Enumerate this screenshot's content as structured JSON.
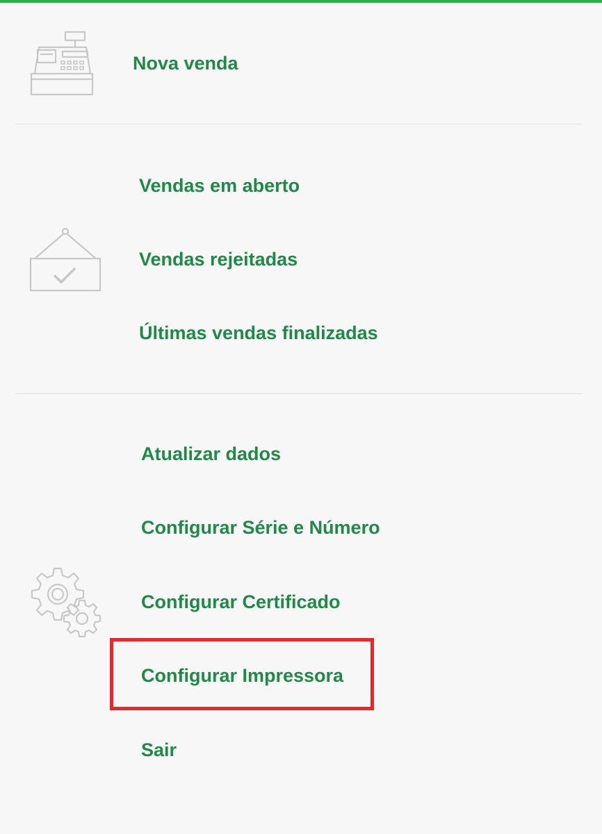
{
  "colors": {
    "accent": "#22b14c",
    "menu_text": "#1f8a45",
    "highlight": "#e8262b",
    "icon_stroke": "#c8c8c8"
  },
  "sections": {
    "sales": {
      "icon": "cash-register-icon",
      "items": [
        "Nova venda"
      ]
    },
    "history": {
      "icon": "hanging-sign-check-icon",
      "items": [
        "Vendas em aberto",
        "Vendas rejeitadas",
        "Últimas vendas finalizadas"
      ]
    },
    "settings": {
      "icon": "gears-icon",
      "items": [
        "Atualizar dados",
        "Configurar Série e Número",
        "Configurar Certificado",
        "Configurar Impressora",
        "Sair"
      ]
    }
  },
  "highlighted_item": "Configurar Impressora"
}
